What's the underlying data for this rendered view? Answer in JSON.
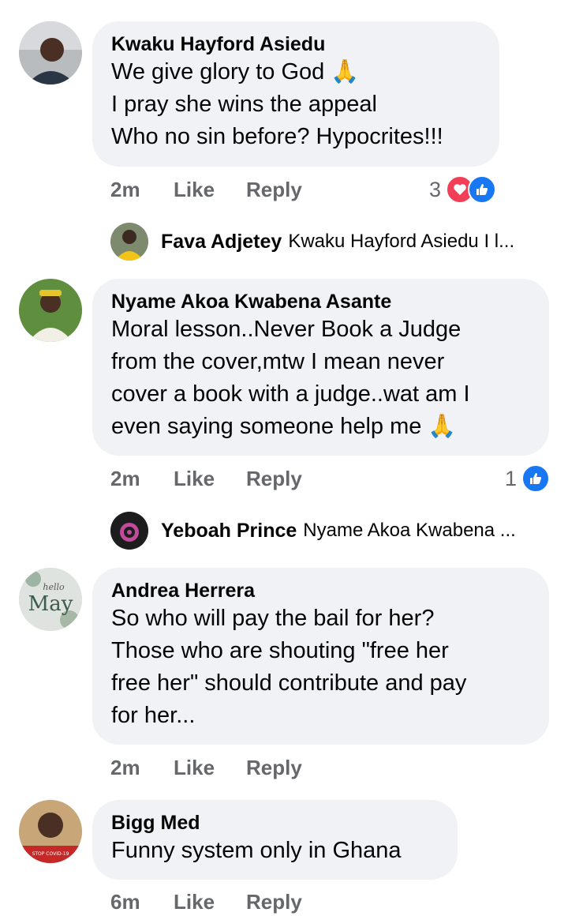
{
  "comments": [
    {
      "author": "Kwaku Hayford Asiedu",
      "text_lines": [
        "We give glory to God 🙏",
        "I pray she wins the appeal",
        "Who no sin before? Hypocrites!!!"
      ],
      "time": "2m",
      "like_label": "Like",
      "reply_label": "Reply",
      "reactions": {
        "count": "3",
        "icons": [
          "love-icon",
          "like-icon"
        ]
      },
      "reply": {
        "author": "Fava Adjetey",
        "snippet": "Kwaku Hayford Asiedu I l..."
      }
    },
    {
      "author": "Nyame Akoa Kwabena Asante",
      "text_lines": [
        "Moral lesson..Never Book a Judge",
        "from the cover,mtw I mean never",
        "cover a book with a judge..wat am I",
        "even saying someone help me 🙏"
      ],
      "time": "2m",
      "like_label": "Like",
      "reply_label": "Reply",
      "reactions": {
        "count": "1",
        "icons": [
          "like-icon"
        ]
      },
      "reply": {
        "author": "Yeboah Prince",
        "snippet": "Nyame Akoa Kwabena ..."
      }
    },
    {
      "author": "Andrea Herrera",
      "text_lines": [
        "So who will pay the bail for her?",
        "Those who are shouting \"free her",
        "free her\" should contribute and pay",
        "for her..."
      ],
      "time": "2m",
      "like_label": "Like",
      "reply_label": "Reply",
      "avatar_text": {
        "small": "hello",
        "big": "May"
      }
    },
    {
      "author": "Bigg Med",
      "text_lines": [
        "Funny system only in Ghana"
      ],
      "time": "6m",
      "like_label": "Like",
      "reply_label": "Reply",
      "avatar_text": {
        "banner": "STOP COVID-19"
      }
    }
  ],
  "colors": {
    "bubble": "#f0f2f5",
    "meta": "#65676b",
    "like_blue": "#1877f2",
    "love_red": "#f33e58"
  }
}
